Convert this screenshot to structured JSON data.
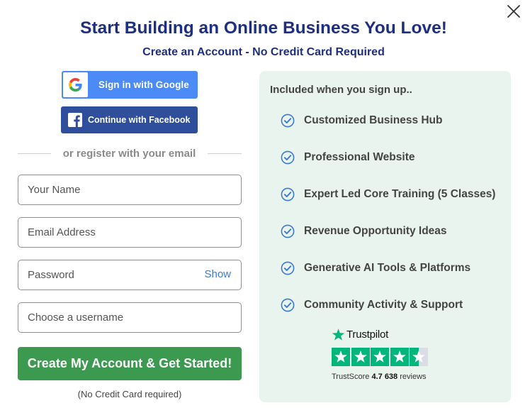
{
  "header": {
    "title": "Start Building an Online Business You Love!",
    "subtitle": "Create an Account - No Credit Card Required"
  },
  "social": {
    "google_label": "Sign in with Google",
    "facebook_label": "Continue with Facebook"
  },
  "divider": {
    "text": "or register with your email"
  },
  "form": {
    "name_placeholder": "Your Name",
    "email_placeholder": "Email Address",
    "password_placeholder": "Password",
    "password_toggle": "Show",
    "username_placeholder": "Choose a username",
    "submit_label": "Create My Account & Get Started!",
    "submit_note": "(No Credit Card required)"
  },
  "benefits": {
    "heading": "Included when you sign up..",
    "items": [
      "Customized Business Hub",
      "Professional Website",
      "Expert Led Core Training (5 Classes)",
      "Revenue Opportunity Ideas",
      "Generative AI Tools & Platforms",
      "Community Activity & Support"
    ]
  },
  "trustpilot": {
    "brand": "Trustpilot",
    "score_label": "TrustScore",
    "score": "4.7",
    "reviews_count": "638",
    "reviews_label": "reviews",
    "rating": 4.7
  },
  "colors": {
    "title": "#1e2f80",
    "google": "#4c8bf5",
    "facebook": "#2f4f9c",
    "cta": "#3b9a4f",
    "panel": "#eaf4ee",
    "check": "#3a7bd5",
    "trustpilot": "#00b67a"
  },
  "icons": {
    "close": "close-icon",
    "google": "google-g-icon",
    "facebook": "facebook-f-icon",
    "check": "check-circle-icon",
    "trustpilot_star": "star-icon"
  }
}
